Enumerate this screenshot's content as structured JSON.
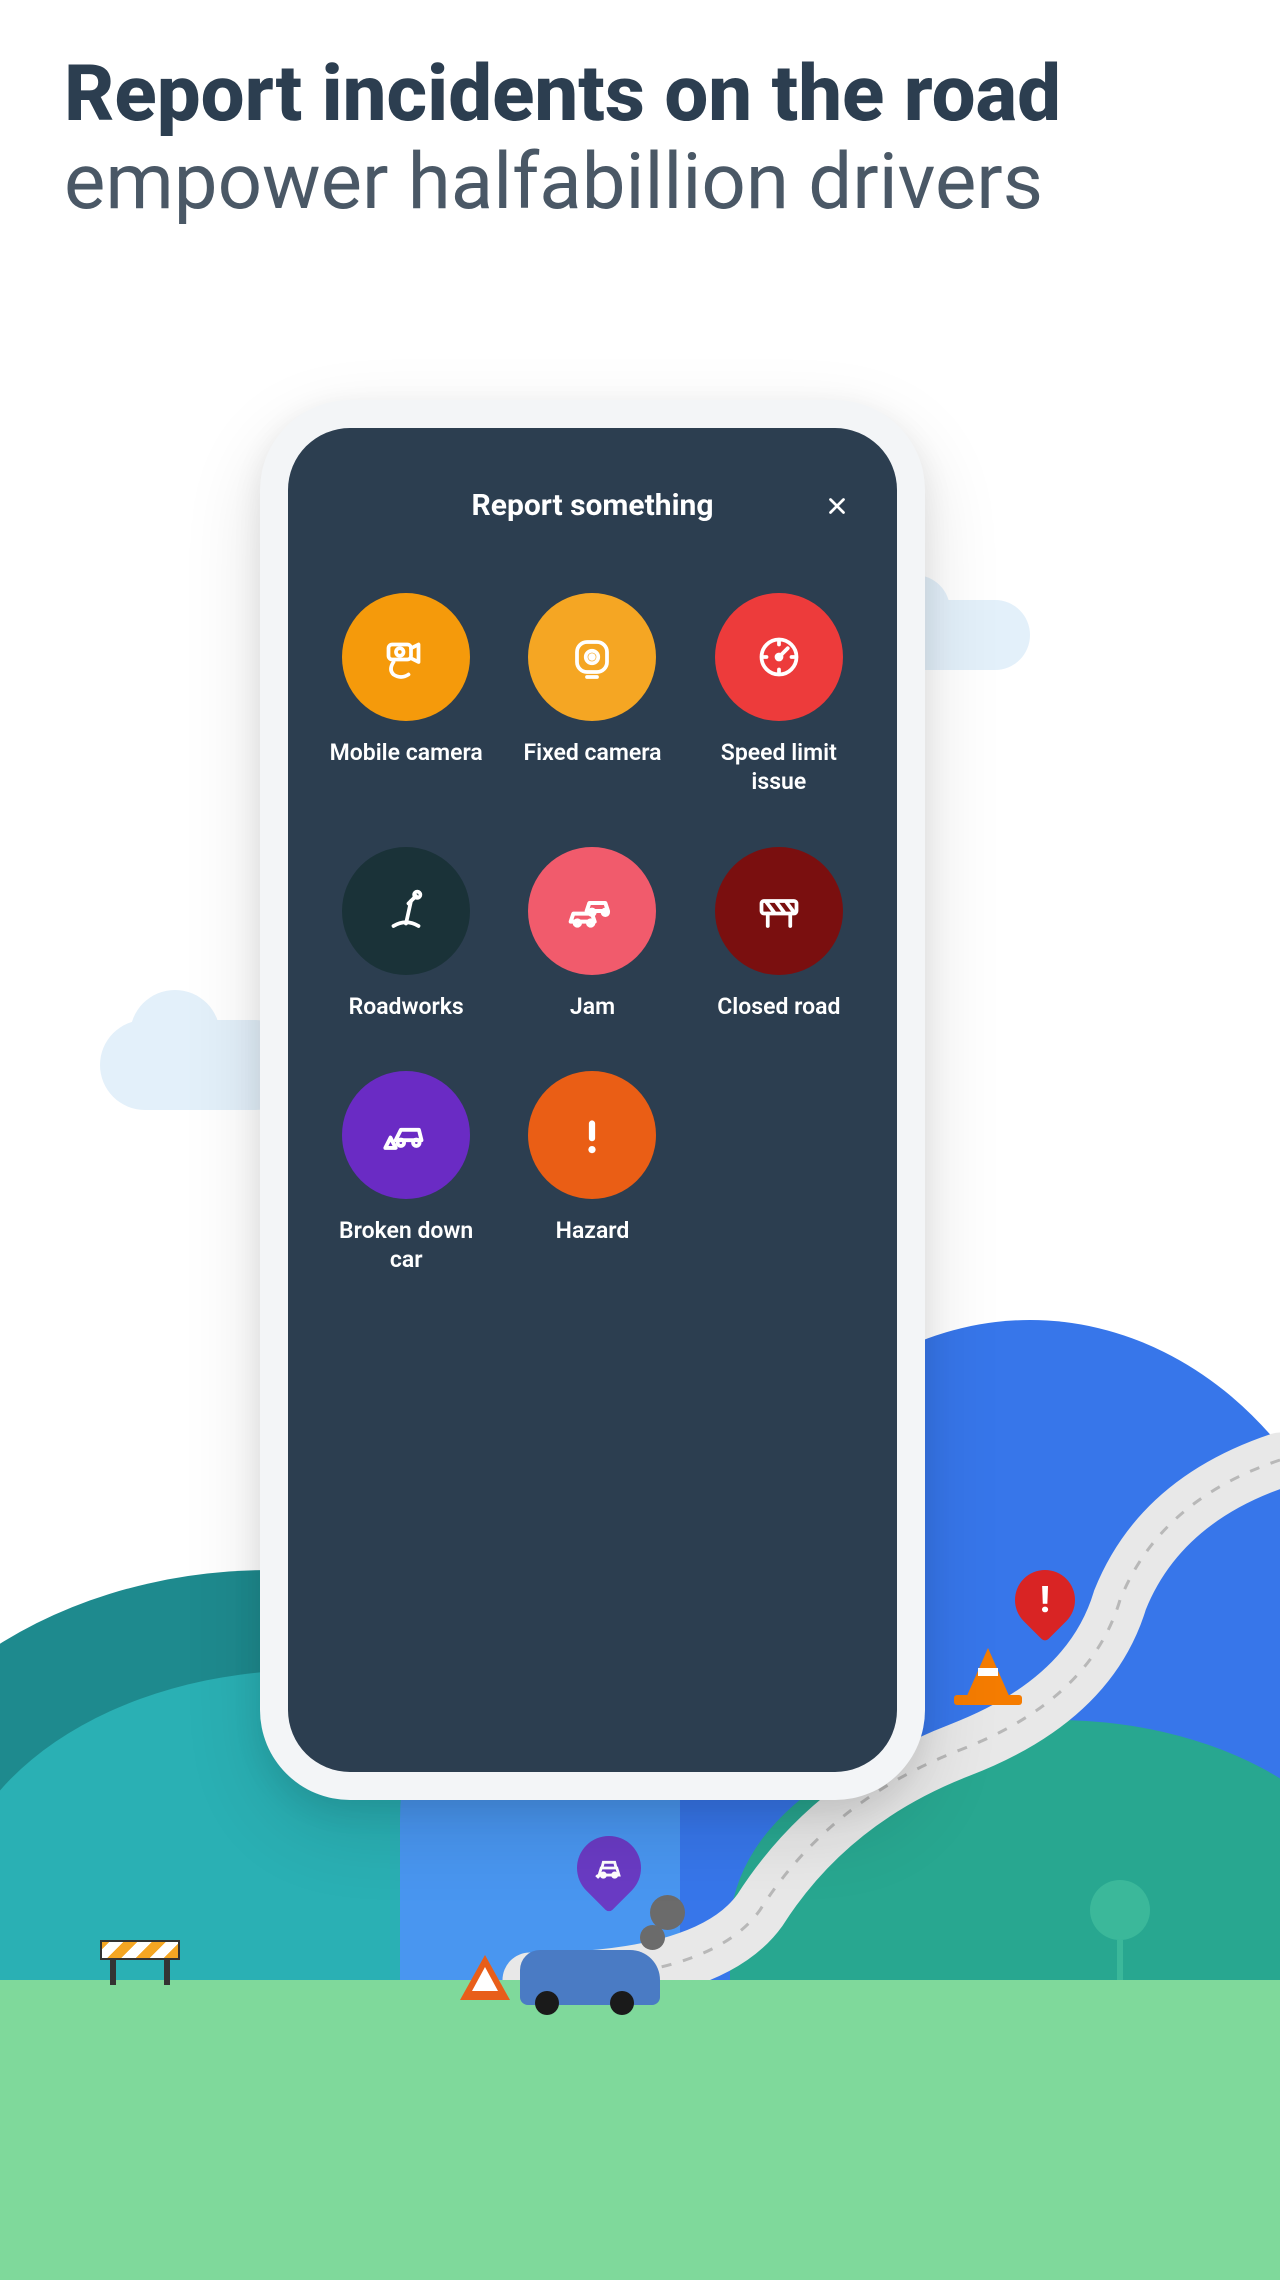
{
  "headline": {
    "bold": "Report incidents on the road",
    "light": "empower halfabillion drivers"
  },
  "screen": {
    "title": "Report something",
    "items": [
      {
        "label": "Mobile camera",
        "icon": "mobile-camera-icon",
        "color": "#f59a0b"
      },
      {
        "label": "Fixed camera",
        "icon": "fixed-camera-icon",
        "color": "#f5a623"
      },
      {
        "label": "Speed limit issue",
        "icon": "speed-limit-icon",
        "color": "#ed3b3b"
      },
      {
        "label": "Roadworks",
        "icon": "roadworks-icon",
        "color": "#1a3238"
      },
      {
        "label": "Jam",
        "icon": "jam-icon",
        "color": "#f15b6c"
      },
      {
        "label": "Closed road",
        "icon": "closed-road-icon",
        "color": "#7a0f0f"
      },
      {
        "label": "Broken down car",
        "icon": "broken-car-icon",
        "color": "#6a2bc4"
      },
      {
        "label": "Hazard",
        "icon": "hazard-icon",
        "color": "#ea5e15"
      }
    ]
  }
}
